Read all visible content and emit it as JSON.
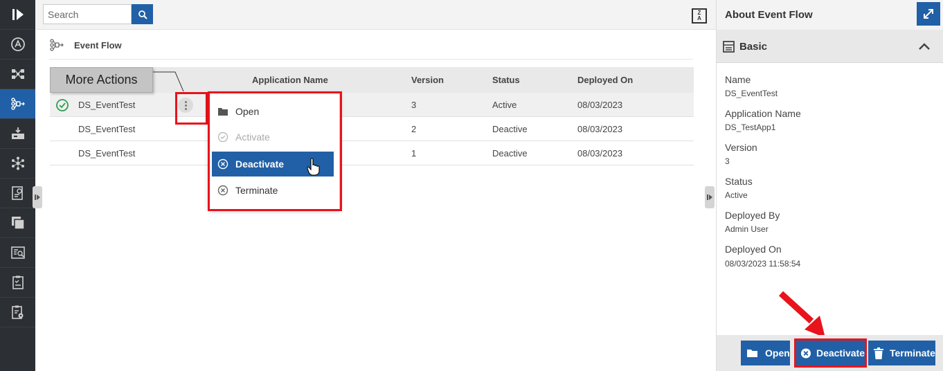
{
  "search": {
    "placeholder": "Search"
  },
  "breadcrumb": {
    "label": "Event Flow"
  },
  "tooltip": {
    "label": "More Actions"
  },
  "table": {
    "headers": [
      "Application Name",
      "Version",
      "Status",
      "Deployed On"
    ],
    "rows": [
      {
        "name": "DS_EventTest",
        "version": "3",
        "status": "Active",
        "deployed": "08/03/2023",
        "selected": true
      },
      {
        "name": "DS_EventTest",
        "version": "2",
        "status": "Deactive",
        "deployed": "08/03/2023"
      },
      {
        "name": "DS_EventTest",
        "version": "1",
        "status": "Deactive",
        "deployed": "08/03/2023"
      }
    ]
  },
  "menu": {
    "items": [
      {
        "label": "Open",
        "icon": "folder-icon"
      },
      {
        "label": "Activate",
        "icon": "check-circle-icon",
        "disabled": true
      },
      {
        "label": "Deactivate",
        "icon": "x-circle-icon",
        "highlighted": true
      },
      {
        "label": "Terminate",
        "icon": "x-circle-icon"
      }
    ]
  },
  "panel": {
    "title": "About Event Flow",
    "section": "Basic",
    "fields": [
      {
        "label": "Name",
        "value": "DS_EventTest"
      },
      {
        "label": "Application Name",
        "value": "DS_TestApp1"
      },
      {
        "label": "Version",
        "value": "3"
      },
      {
        "label": "Status",
        "value": "Active"
      },
      {
        "label": "Deployed By",
        "value": "Admin User"
      },
      {
        "label": "Deployed On",
        "value": "08/03/2023 11:58:54"
      }
    ],
    "buttons": {
      "open": "Open",
      "deactivate": "Deactivate",
      "terminate": "Terminate"
    }
  },
  "colors": {
    "primary": "#2160a6",
    "highlight": "#e8131b",
    "rail": "#2c2f33",
    "active_check": "#2e9e4f"
  }
}
